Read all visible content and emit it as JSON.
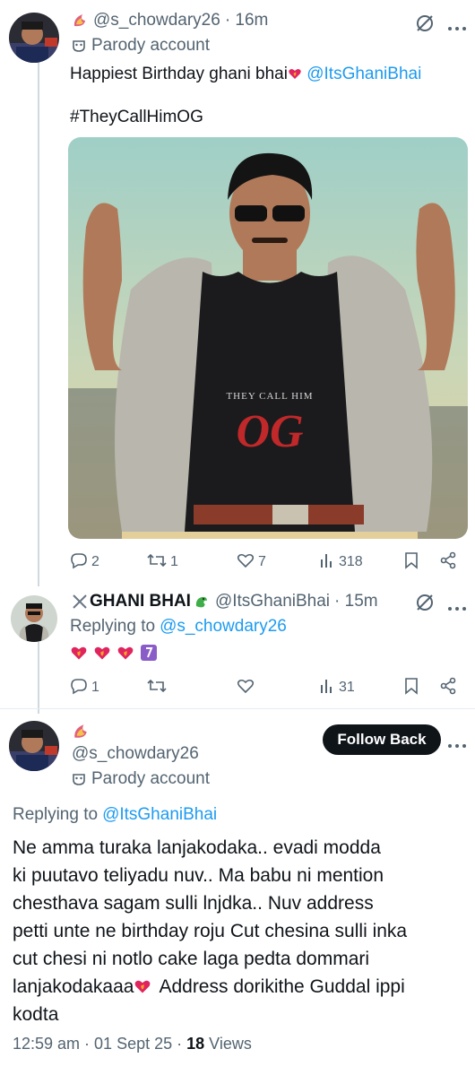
{
  "tweet1": {
    "handle": "@s_chowdary26",
    "time": "· 16m",
    "parody": "Parody account",
    "text": "Happiest Birthday ghani bhai",
    "mention": "@ItsGhaniBhai",
    "hashtag": "#TheyCallHimOG",
    "poster_small": "THEY CALL HIM",
    "poster_big": "OG",
    "replies": "2",
    "reposts": "1",
    "likes": "7",
    "views": "318"
  },
  "reply1": {
    "name": "GHANI BHAI",
    "handle": "@ItsGhaniBhai",
    "time": "· 15m",
    "replying_label": "Replying to",
    "replying_to": "@s_chowdary26",
    "replies": "1",
    "views": "31"
  },
  "main": {
    "handle": "@s_chowdary26",
    "parody": "Parody account",
    "follow_label": "Follow Back",
    "replying_label": "Replying to",
    "replying_to": "@ItsGhaniBhai",
    "body_lines": [
      "Ne amma turaka lanjakodaka.. evadi modda",
      "ki puutavo teliyadu nuv.. Ma babu ni mention",
      "chesthava sagam sulli lnjdka.. Nuv address",
      "petti unte ne birthday roju Cut chesina sulli inka",
      "cut chesi ni notlo cake laga pedta dommari",
      "lanjakodakaaa",
      "Address dorikithe Guddal ippi",
      "kodta"
    ],
    "timestamp": "12:59 am · 01 Sept 25 · ",
    "views_count": "18",
    "views_label": "Views"
  },
  "colors": {
    "link": "#1d9bf0",
    "muted": "#536471",
    "text": "#0f1419"
  }
}
